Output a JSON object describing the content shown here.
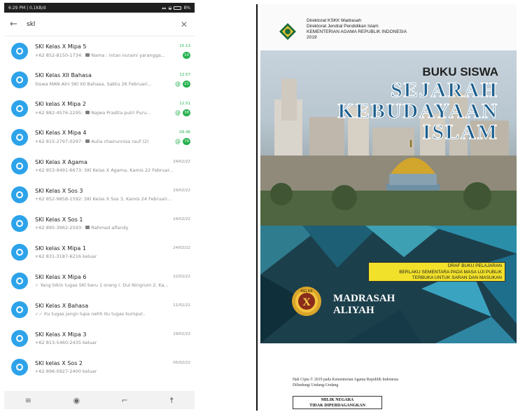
{
  "phone": {
    "status": {
      "time": "6:29 PM | 0,1KB/d",
      "battery": "8%"
    },
    "search": {
      "query": "skl"
    },
    "chats": [
      {
        "name": "SKl Kelas X Mipa 5",
        "time": "15.13",
        "sender": "+62 852-8150-1734:",
        "media": true,
        "tick": "",
        "message": "Nama : intan nuraini yarangga...",
        "mention": false,
        "unread": "10"
      },
      {
        "name": "SKl Kelas XII Bahasa",
        "time": "12.57",
        "sender": "",
        "media": false,
        "tick": "",
        "message": "Siswa MAN Alni SKl XII Bahasa, Sabtu 26 Februari...",
        "mention": true,
        "unread": "21"
      },
      {
        "name": "SKl kelas X Mipa 2",
        "time": "12.51",
        "sender": "+62 882-4576-2295:",
        "media": true,
        "tick": "",
        "message": "Najwa Pradita putri Puru...",
        "mention": true,
        "unread": "38"
      },
      {
        "name": "SKl Kelas X Mipa 4",
        "time": "09.46",
        "sender": "+62 815-2797-0297:",
        "media": true,
        "tick": "",
        "message": "Aulia chairunnisa rauf (2)",
        "mention": true,
        "unread": "79"
      },
      {
        "name": "SKl Kelas X Agama",
        "time": "24/02/22",
        "sender": "+62 853-9491-6673:",
        "media": false,
        "tick": "",
        "message": "SKl Kelas X Agama, Kamis 22 Februar...",
        "mention": false,
        "unread": ""
      },
      {
        "name": "SKl Kelas X Sos 3",
        "time": "24/02/22",
        "sender": "+62 852-9858-1592:",
        "media": false,
        "tick": "",
        "message": "SKl Kelas X Sos 3, Kamis 24 Februari...",
        "mention": false,
        "unread": ""
      },
      {
        "name": "SKl Kelas X Sos 1",
        "time": "24/02/22",
        "sender": "+62 895-3962-2593:",
        "media": true,
        "tick": "",
        "message": "Rahmad alfandy",
        "mention": false,
        "unread": ""
      },
      {
        "name": "SKl kelas X Mipa 1",
        "time": "24/02/22",
        "sender": "+62 831-3187-6216",
        "media": false,
        "tick": "",
        "message": "keluar",
        "mention": false,
        "unread": ""
      },
      {
        "name": "SKl Kelas X Mipa 6",
        "time": "22/02/22",
        "sender": "",
        "media": false,
        "tick": "✓",
        "message": "Yang bikin tugas SKl baru 1 orang I. Dul Ningrum 2. Ka...",
        "mention": false,
        "unread": ""
      },
      {
        "name": "SKl Kelas X Bahasa",
        "time": "11/02/22",
        "sender": "",
        "media": false,
        "tick": "✓✓",
        "message": "Itu tugas jangn lupa nehh itu tugas kumpul..",
        "mention": false,
        "unread": ""
      },
      {
        "name": "SKl Kelas X Mipa 3",
        "time": "19/02/22",
        "sender": "+62 813-5460-2435",
        "media": false,
        "tick": "",
        "message": "keluar",
        "mention": false,
        "unread": ""
      },
      {
        "name": "SKl kelas X Sos 2",
        "time": "05/02/22",
        "sender": "+62 896-0927-2400",
        "media": false,
        "tick": "",
        "message": "keluar",
        "mention": false,
        "unread": ""
      }
    ],
    "colors": {
      "avatar": "#2da3ea",
      "unread": "#22b14c"
    }
  },
  "book": {
    "publisher_lines": [
      "Direktorat KSKK Madrasah",
      "Direktorat Jendral Pendidikan Islam",
      "KEMENTERIAN AGAMA REPUBLIK INDONESIA",
      "2019"
    ],
    "series": "BUKU SISWA",
    "title_lines": [
      "SEJARAH",
      "KEBUDAYAAN",
      "ISLAM"
    ],
    "draft_lines": [
      "DRAF BUKU PELAJARAN",
      "BERLAKU SEMENTARA PADA MASA UJI PUBLIK",
      "TERBUKA UNTUK SARAN DAN MASUKAN"
    ],
    "kelas_label": "KELAS",
    "kelas_value": "X",
    "school_lines": [
      "MADRASAH",
      "ALIYAH"
    ],
    "copyright_lines": [
      "Hak Cipta © 2019 pada Kementerian Agama Republik Indonesia",
      "Dilindungi Undang-Undang"
    ],
    "stamp_lines": [
      "MILIK NEGARA",
      "TIDAK DIPERDAGANGKAN"
    ],
    "colors": {
      "title": "#1d5f8e",
      "draft_box": "#f2e12a",
      "cover_bg": "#2a4d5a"
    }
  }
}
